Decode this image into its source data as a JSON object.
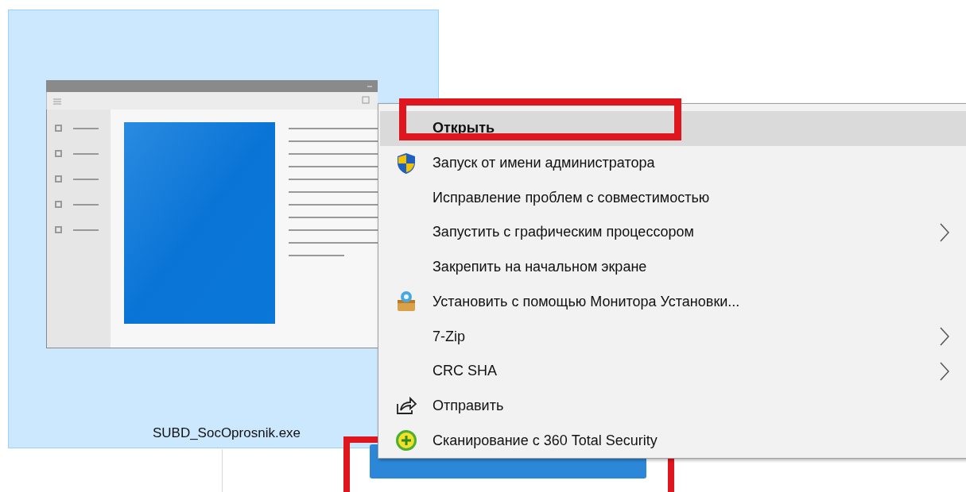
{
  "file": {
    "name": "SUBD_SocOprosnik.exe",
    "selected": true
  },
  "context_menu": {
    "items": [
      {
        "label": "Открыть",
        "kind": "plain",
        "default": true,
        "selected": true,
        "submenu": false
      },
      {
        "label": "Запуск от имени администратора",
        "kind": "shield",
        "default": false,
        "selected": false,
        "submenu": false
      },
      {
        "label": "Исправление проблем с совместимостью",
        "kind": "plain",
        "default": false,
        "selected": false,
        "submenu": false
      },
      {
        "label": "Запустить с графическим процессором",
        "kind": "plain",
        "default": false,
        "selected": false,
        "submenu": true
      },
      {
        "label": "Закрепить на начальном экране",
        "kind": "plain",
        "default": false,
        "selected": false,
        "submenu": false
      },
      {
        "label": "Установить с помощью Монитора Установки...",
        "kind": "package",
        "default": false,
        "selected": false,
        "submenu": false
      },
      {
        "label": "7-Zip",
        "kind": "plain",
        "default": false,
        "selected": false,
        "submenu": true
      },
      {
        "label": "CRC SHA",
        "kind": "plain",
        "default": false,
        "selected": false,
        "submenu": true
      },
      {
        "label": "Отправить",
        "kind": "share",
        "default": false,
        "selected": false,
        "submenu": false
      },
      {
        "label": "Сканирование с 360 Total Security",
        "kind": "scan",
        "default": false,
        "selected": false,
        "submenu": false
      }
    ]
  }
}
